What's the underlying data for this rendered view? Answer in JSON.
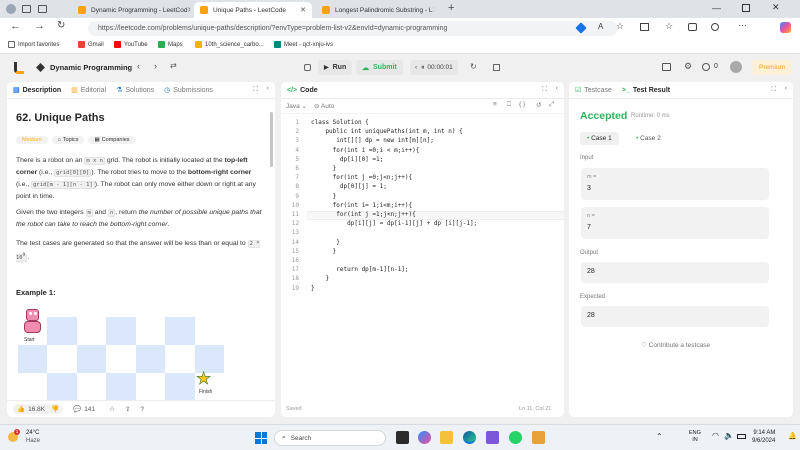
{
  "browser": {
    "tabs": [
      {
        "title": "Dynamic Programming - LeetCod",
        "active": false
      },
      {
        "title": "Unique Paths - LeetCode",
        "active": true
      },
      {
        "title": "Longest Palindromic Substring - L",
        "active": false
      }
    ],
    "url": "https://leetcode.com/problems/unique-paths/description/?envType=problem-list-v2&envId=dynamic-programming",
    "reading_label": "A",
    "favorites": [
      "Import favorites",
      "Gmail",
      "YouTube",
      "Maps",
      "10th_science_carbo...",
      "Meet - qct-xnju-ivs"
    ]
  },
  "header": {
    "list_title": "Dynamic Programming",
    "run_label": "Run",
    "submit_label": "Submit",
    "timer": "00:00:01",
    "coins": "0",
    "premium_label": "Premium"
  },
  "description_panel": {
    "tabs": [
      "Description",
      "Editorial",
      "Solutions",
      "Submissions"
    ],
    "title": "62. Unique Paths",
    "difficulty": "Medium",
    "chips": [
      "Topics",
      "Companies"
    ],
    "p1": {
      "t1": "There is a robot on an ",
      "c1": "m x n",
      "t2": " grid. The robot is initially located at the ",
      "b1": "top-left corner",
      "t3": " (i.e., ",
      "c2": "grid[0][0]",
      "t4": "). The robot tries to move to the ",
      "b2": "bottom-right corner",
      "t5": " (i.e., ",
      "c3": "grid[m - 1][n - 1]",
      "t6": "). The robot can only move either down or right at any point in time."
    },
    "p2": {
      "t1": "Given the two integers ",
      "c1": "m",
      "t2": " and ",
      "c2": "n",
      "t3": ", return ",
      "i1": "the number of possible unique paths that the robot can take to reach the bottom-right corner",
      "t4": "."
    },
    "p3": {
      "t1": "The test cases are generated so that the answer will be less than or equal to ",
      "c1": "2 * 10",
      "sup": "9",
      "t2": "."
    },
    "example_heading": "Example 1:",
    "start_label": "Start",
    "finish_label": "Finish",
    "footer": {
      "likes": "16.8K",
      "comments": "141"
    }
  },
  "code_panel": {
    "tab_label": "Code",
    "language": "Java",
    "auto_label": "Auto",
    "lines": [
      "class Solution {",
      "    public int uniquePaths(int m, int n) {",
      "       int[][] dp = new int[m][n];",
      "      for(int i =0;i < m;i++){",
      "        dp[i][0] =1;",
      "      }",
      "      for(int j =0;j<n;j++){",
      "        dp[0][j] = 1;",
      "      }",
      "      for(int i= 1;i<m;i++){",
      "       for(int j =1;j<n;j++){",
      "          dp[i][j] = dp[i-1][j] + dp [i][j-1];",
      "",
      "       }",
      "      }",
      "",
      "       return dp[m-1][n-1];",
      "    }",
      "}"
    ],
    "saved_label": "Saved",
    "cursor_pos": "Ln 11, Col 21"
  },
  "result_panel": {
    "tabs": [
      "Testcase",
      "Test Result"
    ],
    "status": "Accepted",
    "runtime": "Runtime: 0 ms",
    "cases": [
      "Case 1",
      "Case 2"
    ],
    "input_label": "Input",
    "inputs": [
      {
        "name": "m =",
        "value": "3"
      },
      {
        "name": "n =",
        "value": "7"
      }
    ],
    "output_label": "Output",
    "output": "28",
    "expected_label": "Expected",
    "expected": "28",
    "contribute_label": "Contribute a testcase"
  },
  "taskbar": {
    "weather_temp": "24°C",
    "weather_text": "Haze",
    "search_placeholder": "Search",
    "lang1": "ENG",
    "lang2": "IN",
    "time": "9:14 AM",
    "date": "9/6/2024",
    "notif_count": "1"
  },
  "colors": {
    "accepted": "#2db55d",
    "premium": "#ffa116",
    "submit": "#2db55d",
    "grid_blue": "#dbe8fb"
  }
}
